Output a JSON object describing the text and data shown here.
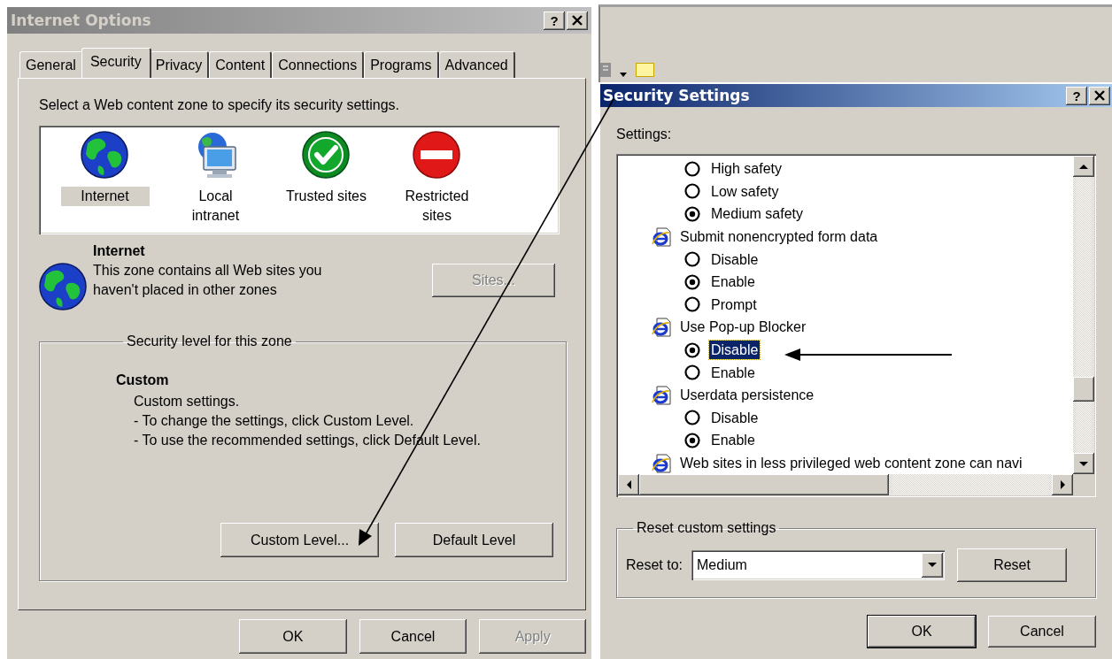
{
  "internet_options": {
    "title": "Internet Options",
    "help_label": "?",
    "tabs": [
      {
        "label": "General",
        "selected": false
      },
      {
        "label": "Security",
        "selected": true
      },
      {
        "label": "Privacy",
        "selected": false
      },
      {
        "label": "Content",
        "selected": false
      },
      {
        "label": "Connections",
        "selected": false
      },
      {
        "label": "Programs",
        "selected": false
      },
      {
        "label": "Advanced",
        "selected": false
      }
    ],
    "instruction": "Select a Web content zone to specify its security settings.",
    "zones": [
      {
        "kind": "globe",
        "label": "Internet",
        "selected": true
      },
      {
        "kind": "intranet",
        "label": "Local intranet",
        "selected": false
      },
      {
        "kind": "trusted",
        "label": "Trusted sites",
        "selected": false
      },
      {
        "kind": "restricted",
        "label": "Restricted sites",
        "selected": false
      }
    ],
    "zone_info": {
      "name": "Internet",
      "description": "This zone contains all Web sites you haven't placed in other zones"
    },
    "sites_button": {
      "label": "Sites...",
      "disabled": true
    },
    "security_level": {
      "legend": "Security level for this zone",
      "level_name": "Custom",
      "lines": [
        "Custom settings.",
        "- To change the settings, click Custom Level.",
        "- To use the recommended settings, click Default Level."
      ],
      "buttons": [
        {
          "label": "Custom Level...",
          "disabled": false
        },
        {
          "label": "Default Level",
          "disabled": false
        }
      ]
    },
    "buttons": [
      {
        "label": "OK",
        "disabled": false
      },
      {
        "label": "Cancel",
        "disabled": false
      },
      {
        "label": "Apply",
        "disabled": true
      }
    ]
  },
  "security_settings": {
    "title": "Security Settings",
    "help_label": "?",
    "settings_label": "Settings:",
    "items": [
      {
        "kind": "option",
        "label": "High safety",
        "selected": false,
        "focused": false
      },
      {
        "kind": "option",
        "label": "Low safety",
        "selected": false,
        "focused": false
      },
      {
        "kind": "option",
        "label": "Medium safety",
        "selected": true,
        "focused": false
      },
      {
        "kind": "setting",
        "label": "Submit nonencrypted form data",
        "children": [
          {
            "kind": "option",
            "label": "Disable",
            "selected": false,
            "focused": false
          },
          {
            "kind": "option",
            "label": "Enable",
            "selected": true,
            "focused": false
          },
          {
            "kind": "option",
            "label": "Prompt",
            "selected": false,
            "focused": false
          }
        ]
      },
      {
        "kind": "setting",
        "label": "Use Pop-up Blocker",
        "children": [
          {
            "kind": "option",
            "label": "Disable",
            "selected": true,
            "focused": true
          },
          {
            "kind": "option",
            "label": "Enable",
            "selected": false,
            "focused": false
          }
        ]
      },
      {
        "kind": "setting",
        "label": "Userdata persistence",
        "children": [
          {
            "kind": "option",
            "label": "Disable",
            "selected": false,
            "focused": false
          },
          {
            "kind": "option",
            "label": "Enable",
            "selected": true,
            "focused": false
          }
        ]
      },
      {
        "kind": "setting",
        "label": "Web sites in less privileged web content zone can navi"
      }
    ],
    "reset_group": {
      "legend": "Reset custom settings",
      "label": "Reset to:",
      "value": "Medium",
      "button": "Reset"
    },
    "buttons": [
      {
        "label": "OK",
        "default": true
      },
      {
        "label": "Cancel",
        "default": false
      }
    ]
  }
}
